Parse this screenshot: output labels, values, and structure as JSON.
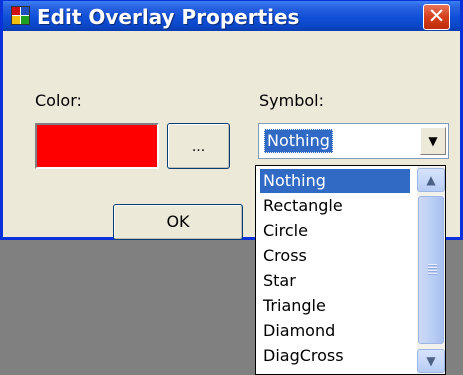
{
  "window": {
    "title": "Edit Overlay Properties",
    "close_glyph": "✕"
  },
  "color": {
    "label": "Color:",
    "value_color": "#ff0000",
    "browse_label": "..."
  },
  "symbol": {
    "label": "Symbol:",
    "selected": "Nothing",
    "options": [
      "Nothing",
      "Rectangle",
      "Circle",
      "Cross",
      "Star",
      "Triangle",
      "Diamond",
      "DiagCross"
    ]
  },
  "buttons": {
    "ok_label": "OK"
  },
  "icons": {
    "app": "app-grid-icon",
    "close": "close-icon",
    "dropdown": "chevron-down-icon",
    "scroll_up": "chevron-up-icon",
    "scroll_down": "chevron-down-icon"
  },
  "colors": {
    "titlebar": "#0b46c6",
    "selection": "#316ac5",
    "dialog_bg": "#ece9d8",
    "desktop_bg": "#808080"
  }
}
